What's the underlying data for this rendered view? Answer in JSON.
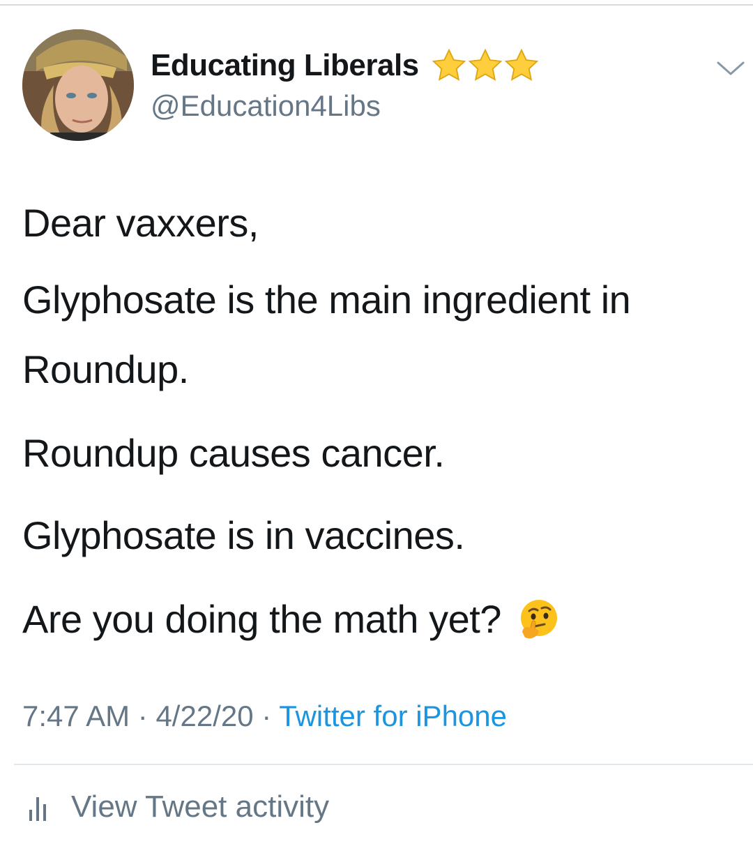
{
  "author": {
    "display_name": "Educating Liberals",
    "handle": "@Education4Libs",
    "badge_icons": [
      "star-icon",
      "star-icon",
      "star-icon"
    ]
  },
  "tweet": {
    "paragraphs": [
      "Dear vaxxers,",
      "Glyphosate is the main ingredient in Roundup.",
      "Roundup causes cancer.",
      "Glyphosate is in vaccines.",
      "Are you doing the math yet?"
    ],
    "trailing_emoji": "thinking-face-icon"
  },
  "meta": {
    "time": "7:47 AM",
    "separator": "·",
    "date": "4/22/20",
    "source": "Twitter for iPhone"
  },
  "footer": {
    "activity_label": "View Tweet activity",
    "activity_icon": "bar-chart-icon"
  },
  "colors": {
    "text": "#14171a",
    "secondary": "#657786",
    "link": "#1b95e0",
    "divider": "#e1e8ed"
  }
}
